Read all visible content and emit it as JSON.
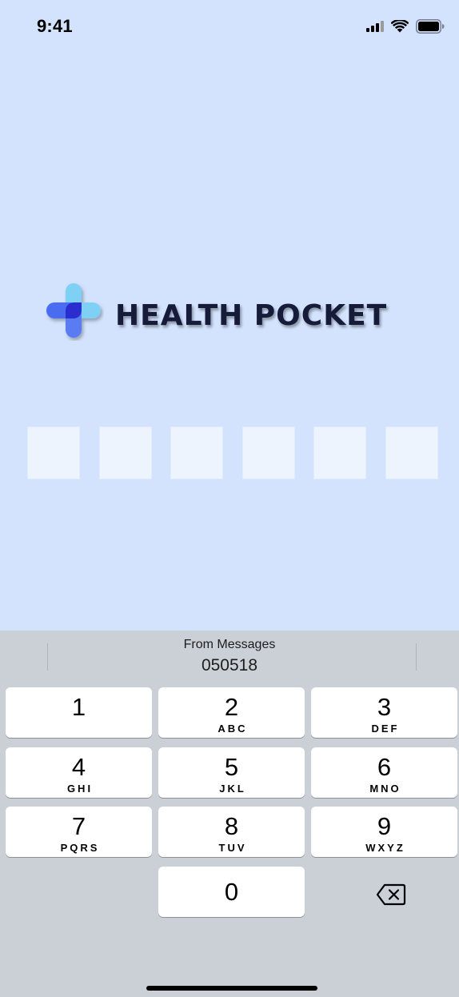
{
  "status_bar": {
    "time": "9:41",
    "icons": [
      "cellular-signal-icon",
      "wifi-icon",
      "battery-icon"
    ]
  },
  "app": {
    "logo_icon": "medical-cross-icon",
    "logo_text": "HEALTH POCKET",
    "otp_length": 6,
    "otp_values": [
      "",
      "",
      "",
      "",
      "",
      ""
    ]
  },
  "keyboard": {
    "suggestion_title": "From Messages",
    "suggestion_code": "050518",
    "keys": [
      {
        "digit": "1",
        "letters": ""
      },
      {
        "digit": "2",
        "letters": "ABC"
      },
      {
        "digit": "3",
        "letters": "DEF"
      },
      {
        "digit": "4",
        "letters": "GHI"
      },
      {
        "digit": "5",
        "letters": "JKL"
      },
      {
        "digit": "6",
        "letters": "MNO"
      },
      {
        "digit": "7",
        "letters": "PQRS"
      },
      {
        "digit": "8",
        "letters": "TUV"
      },
      {
        "digit": "9",
        "letters": "WXYZ"
      },
      {
        "digit": "0",
        "letters": ""
      }
    ],
    "delete_icon": "backspace-icon"
  },
  "colors": {
    "background": "#d3e3fd",
    "otp_box": "#eef4fd",
    "keyboard_bg": "#cbcfd6",
    "key_bg": "#ffffff",
    "logo_text": "#171b3a",
    "logo_light_blue": "#7fd0f5",
    "logo_blue": "#4a6cf0",
    "logo_dark_blue": "#2b2fcf"
  }
}
